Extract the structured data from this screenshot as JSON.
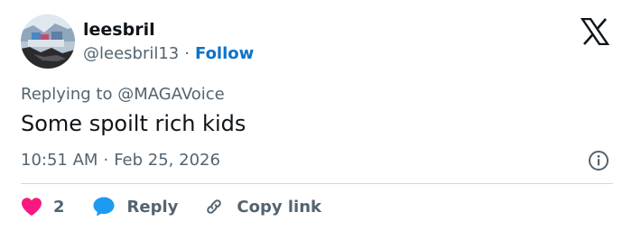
{
  "author": {
    "name": "leesbril",
    "handle": "@leesbril13",
    "separator": "·",
    "follow_label": "Follow"
  },
  "reply_context": {
    "prefix": "Replying to",
    "mention": "@MAGAVoice"
  },
  "tweet": {
    "text": "Some spoilt rich kids",
    "time": "10:51 AM",
    "separator": "·",
    "date": "Feb 25, 2026"
  },
  "actions": {
    "like_count": "2",
    "reply_label": "Reply",
    "copy_link_label": "Copy link"
  },
  "colors": {
    "like": "#f91880",
    "reply_bubble": "#1d9bf0",
    "follow": "#0a73c7",
    "secondary_text": "#536471"
  },
  "icons": {
    "brand": "x-logo-icon",
    "info": "info-icon",
    "like": "heart-icon",
    "reply": "speech-bubble-icon",
    "copy": "link-icon"
  }
}
